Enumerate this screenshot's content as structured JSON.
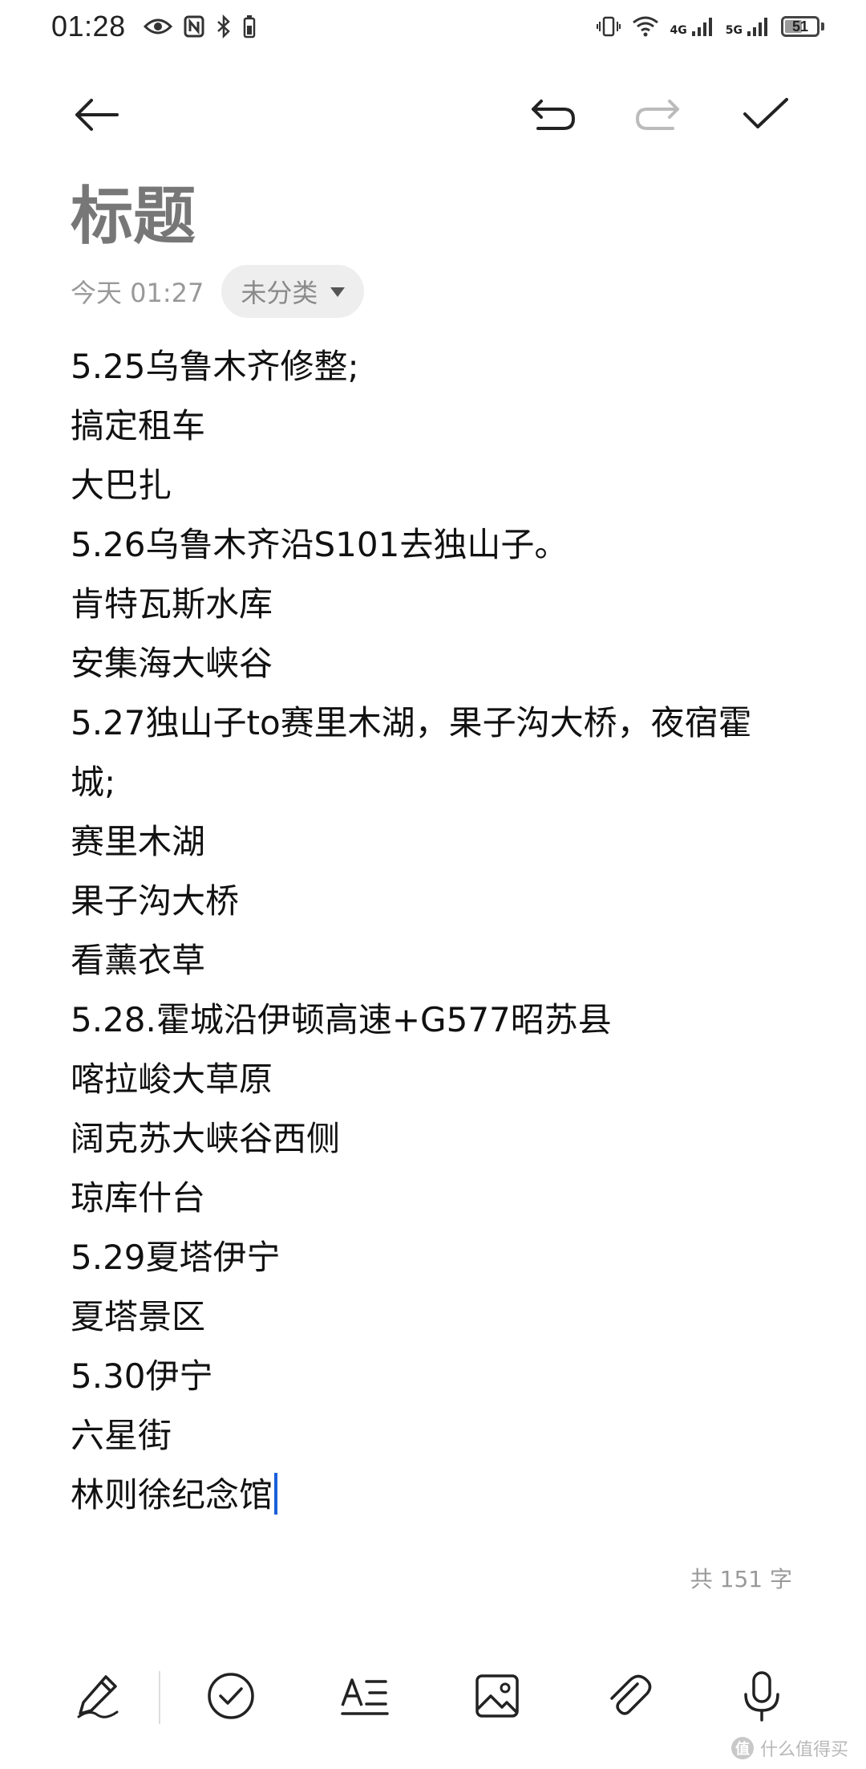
{
  "status_bar": {
    "time": "01:28",
    "left_icons": [
      "eye-icon",
      "nfc-icon",
      "bluetooth-icon",
      "battery-saver-icon"
    ],
    "right_icons": [
      "vibrate-icon",
      "wifi-icon",
      "signal-4g-icon",
      "signal-5g-icon"
    ],
    "network_1": "4G",
    "network_2": "5G",
    "battery_level": "51"
  },
  "toolbar": {
    "back_icon": "arrow-left-icon",
    "undo_icon": "undo-icon",
    "redo_icon": "redo-icon",
    "confirm_icon": "checkmark-icon"
  },
  "note": {
    "title": "标题",
    "date": "今天 01:27",
    "category": "未分类",
    "lines": [
      "5.25乌鲁木齐修整;",
      "搞定租车",
      "大巴扎",
      "5.26乌鲁木齐沿S101去独山子。",
      "肯特瓦斯水库",
      "安集海大峡谷",
      "5.27独山子to赛里木湖，果子沟大桥，夜宿霍",
      "城;",
      "赛里木湖",
      "果子沟大桥",
      "看薰衣草",
      "5.28.霍城沿伊顿高速+G577昭苏县",
      "喀拉峻大草原",
      "阔克苏大峡谷西侧",
      "琼库什台",
      "5.29夏塔伊宁",
      "夏塔景区",
      "5.30伊宁",
      "六星街",
      "林则徐纪念馆"
    ],
    "word_count": "共 151 字"
  },
  "bottom_bar": {
    "items": [
      "handwriting-icon",
      "checklist-icon",
      "text-style-icon",
      "image-icon",
      "attachment-icon",
      "microphone-icon"
    ]
  },
  "watermark": {
    "badge": "值",
    "text": "什么值得买"
  },
  "colors": {
    "caret": "#1a5fd9",
    "title": "#777777",
    "muted": "#999999"
  }
}
